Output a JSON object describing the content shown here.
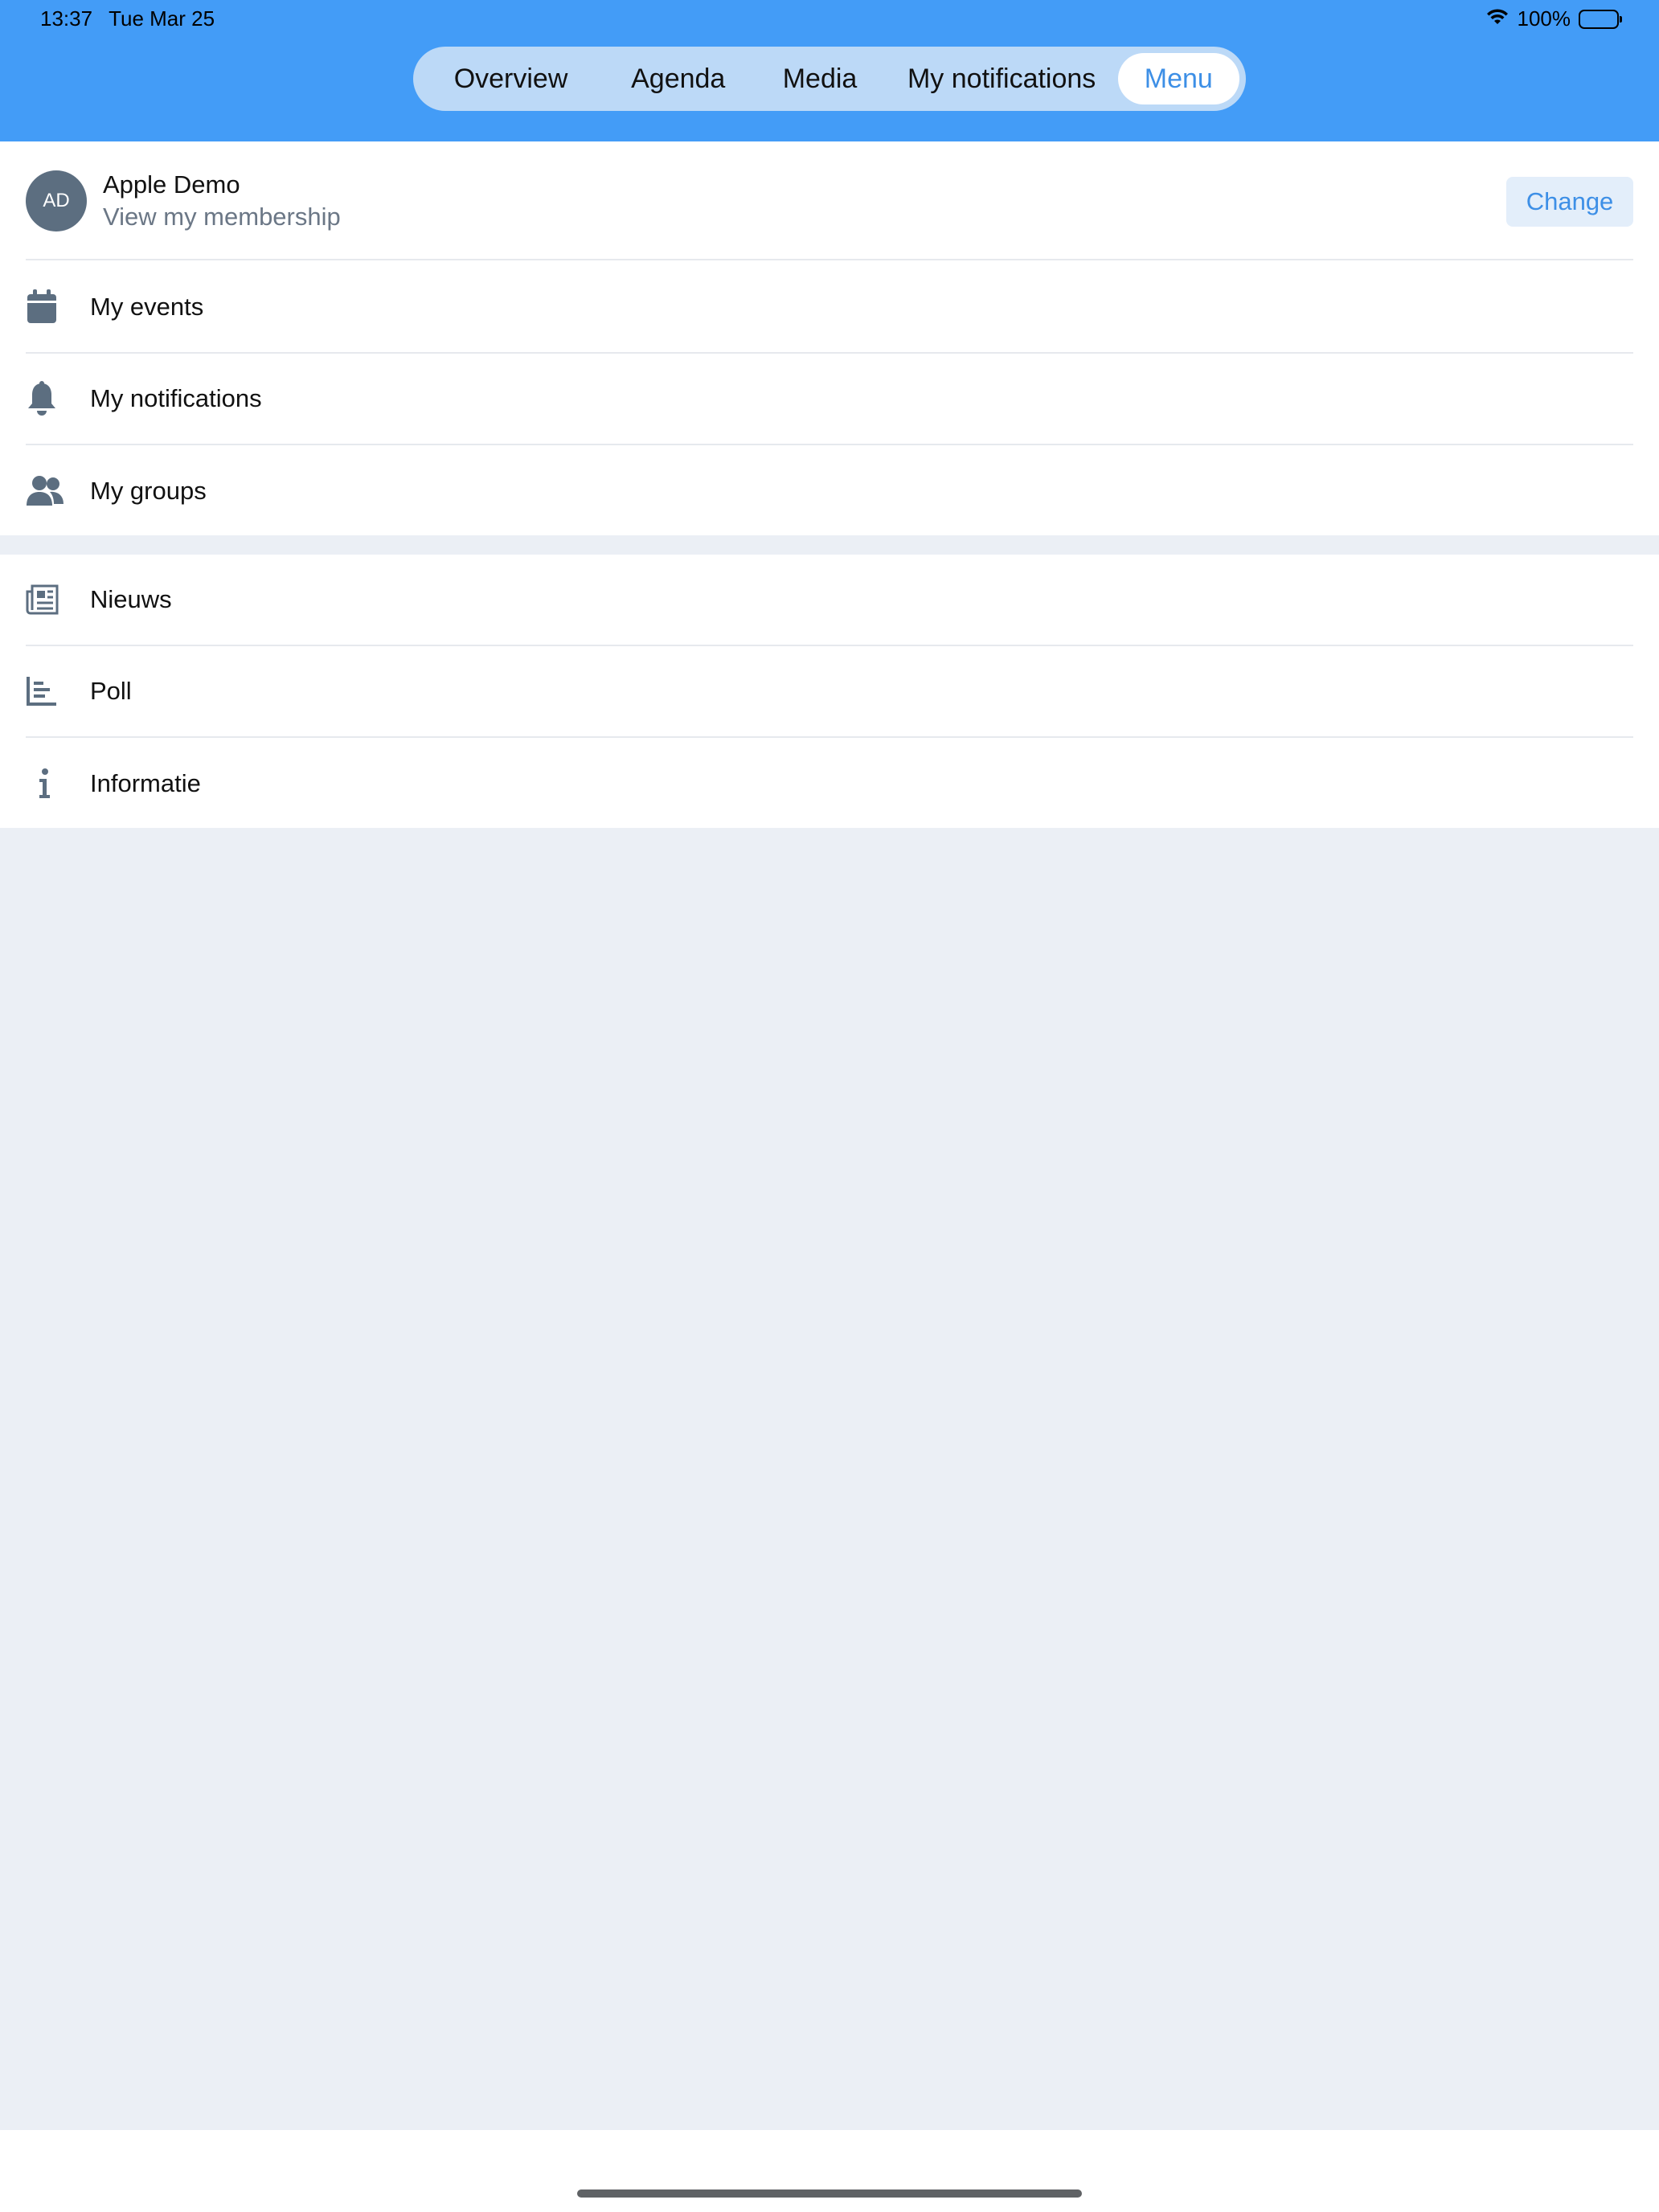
{
  "status_bar": {
    "time": "13:37",
    "date": "Tue Mar 25",
    "battery": "100%"
  },
  "tabs": [
    {
      "label": "Overview",
      "selected": false
    },
    {
      "label": "Agenda",
      "selected": false
    },
    {
      "label": "Media",
      "selected": false
    },
    {
      "label": "My notifications",
      "selected": false
    },
    {
      "label": "Menu",
      "selected": true
    }
  ],
  "profile": {
    "initials": "AD",
    "name": "Apple Demo",
    "subtitle": "View my membership",
    "change_label": "Change"
  },
  "personal_items": [
    {
      "label": "My events",
      "icon": "calendar-icon"
    },
    {
      "label": "My notifications",
      "icon": "bell-icon"
    },
    {
      "label": "My groups",
      "icon": "users-icon"
    }
  ],
  "module_items": [
    {
      "label": "Nieuws",
      "icon": "newspaper-icon"
    },
    {
      "label": "Poll",
      "icon": "bar-chart-icon"
    },
    {
      "label": "Informatie",
      "icon": "info-icon"
    }
  ],
  "colors": {
    "header": "#439cf7",
    "accent": "#3d8fe6",
    "icon": "#5c6e80",
    "background": "#ebeff5"
  }
}
